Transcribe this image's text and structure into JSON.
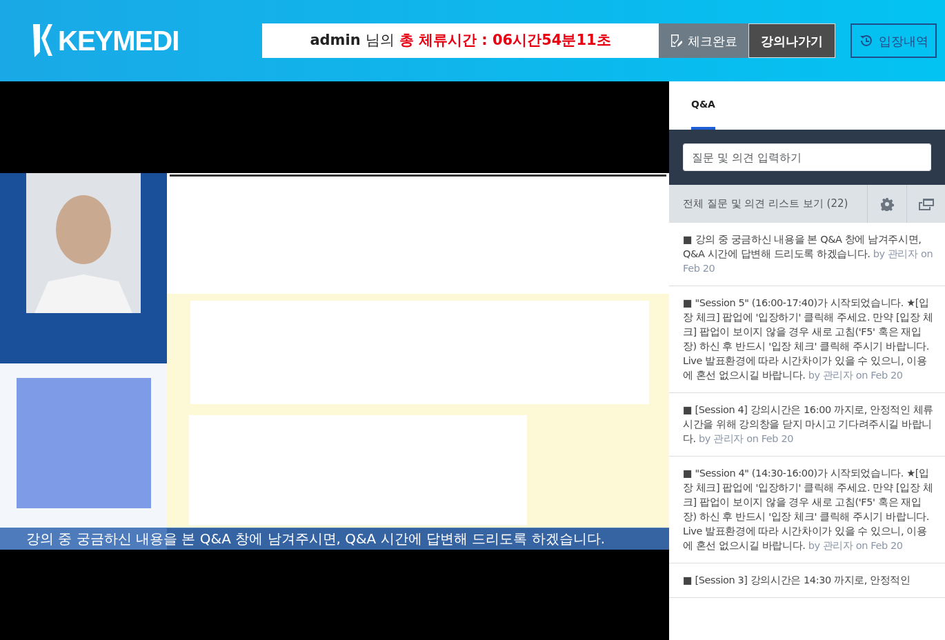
{
  "header": {
    "logo": "KEYMEDI",
    "user": "admin",
    "user_suffix": "님의",
    "stay_label": "총 체류시간 : 06시간54분11초",
    "buttons": [
      {
        "label": "체크완료",
        "kind": "check"
      },
      {
        "label": "강의나가기",
        "kind": "exit"
      },
      {
        "label": "입장내역",
        "kind": "history"
      }
    ]
  },
  "video": {
    "kind": "picture",
    "caption": "강의 중 궁금하신 내용을 본 Q&A 창에 남겨주시면, Q&A 시간에 답변해 드리도록 하겠습니다."
  },
  "tabs": [
    {
      "label": "Q&A",
      "selected": true
    }
  ],
  "question_input": {
    "placeholder": "질문 및 의견 입력하기"
  },
  "list_bar": {
    "label": "전체 질문 및 의견 리스트 보기 (22)"
  },
  "messages": [
    {
      "text": "■ 강의 중 궁금하신 내용을 본 Q&A 창에 남겨주시면, Q&A 시간에 답변해 드리도록 하겠습니다. ",
      "meta": "by 관리자 on Feb 20"
    },
    {
      "text": "■ \"Session 5\" (16:00-17:40)가 시작되었습니다. ★[입장 체크] 팝업에 '입장하기' 클릭해 주세요. 만약 [입장 체크] 팝업이 보이지 않을 경우 새로 고침('F5' 혹은 재입장) 하신 후 반드시 '입장 체크' 클릭해 주시기 바랍니다. Live 발표환경에 따라 시간차이가 있을 수 있으니, 이용에 혼선 없으시길 바랍니다. ",
      "meta": "by 관리자 on Feb 20"
    },
    {
      "text": "■ [Session 4] 강의시간은 16:00 까지로, 안정적인 체류시간을 위해 강의창을 닫지 마시고 기다려주시길 바랍니다. ",
      "meta": "by 관리자 on Feb 20"
    },
    {
      "text": "■ \"Session 4\" (14:30-16:00)가 시작되었습니다. ★[입장 체크] 팝업에 '입장하기' 클릭해 주세요. 만약 [입장 체크] 팝업이 보이지 않을 경우 새로 고침('F5' 혹은 재입장) 하신 후 반드시 '입장 체크' 클릭해 주시기 바랍니다. Live 발표환경에 따라 시간차이가 있을 수 있으니, 이용에 혼선 없으시길 바랍니다. ",
      "meta": "by 관리자 on Feb 20"
    },
    {
      "text": "■ [Session 3] 강의시간은 14:30 까지로, 안정적인"
    }
  ]
}
